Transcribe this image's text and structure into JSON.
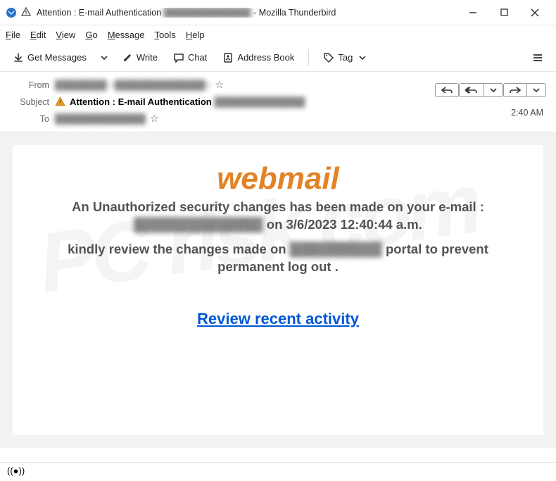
{
  "window": {
    "title_prefix": "Attention : E-mail Authentication",
    "title_redacted": "██████████████",
    "title_suffix": " - Mozilla Thunderbird"
  },
  "menu": [
    "File",
    "Edit",
    "View",
    "Go",
    "Message",
    "Tools",
    "Help"
  ],
  "toolbar": {
    "get_messages": "Get Messages",
    "write": "Write",
    "chat": "Chat",
    "address_book": "Address Book",
    "tag": "Tag"
  },
  "headers": {
    "from_label": "From",
    "from_value": "████████ <██████████████>",
    "subject_label": "Subject",
    "subject_prefix": "Attention : E-mail Authentication",
    "subject_redacted": "██████████████",
    "to_label": "To",
    "to_value": "██████████████",
    "time": "2:40 AM"
  },
  "body": {
    "logo": "webmail",
    "line1_a": "An Unauthorized security changes has been made on your e-mail :",
    "line1_redacted": "██████████████",
    "line1_b": "on 3/6/2023 12:40:44 a.m.",
    "line2_a": "kindly review the changes made on",
    "line2_redacted": "██████████",
    "line2_b": "portal to prevent permanent log out .",
    "link": "Review recent activity"
  },
  "watermark": "PC risk.com"
}
